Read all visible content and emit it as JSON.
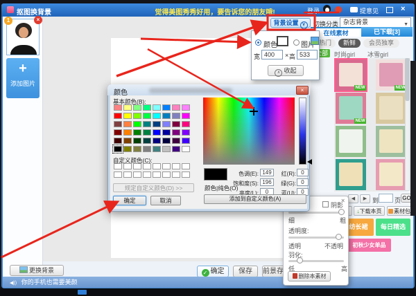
{
  "colors": {
    "annotation": "#e8251c",
    "titlebar_blue": "#2273cd",
    "accent_blue": "#2a8ad0",
    "tag_green": "#53b83a",
    "selected_pink": "#ff5d8f"
  },
  "icons": {
    "plus": "+",
    "speaker": "◀))",
    "dropdown": "▼",
    "collapse_caret": "∧",
    "settings_caret": "∨",
    "close": "×",
    "check": "✓",
    "prev": "◀",
    "next": "▶",
    "download_arrow": "↓"
  },
  "titlebar": {
    "title": "抠图换背景",
    "promo": "觉得美图秀秀好用，要告诉您的朋友哦!",
    "login": "登录",
    "feedback": "提意见"
  },
  "left_panel": {
    "photo_index": "1",
    "add_image": "添加图片",
    "change_background": "更换背景"
  },
  "bg_settings": {
    "button_label": "背景设置",
    "color_option": "颜色",
    "image_option": "图片",
    "width_label": "宽",
    "width_value": "400",
    "multiply": "×",
    "height_label": "高",
    "height_value": "533",
    "collapse_label": "收起"
  },
  "color_dialog": {
    "title": "颜色",
    "basic_colors_label": "基本颜色(B):",
    "custom_colors_label": "自定义颜色(C):",
    "define_custom_label": "规定自定义颜色(D) >>",
    "ok": "确定",
    "cancel": "取消",
    "solid_label": "颜色|纯色(O)",
    "add_custom": "添加到自定义颜色(A)",
    "preview_color": "#000000",
    "selected_index": 40,
    "fields": {
      "hue_label": "色调(E):",
      "hue": "149",
      "sat_label": "饱和度(S):",
      "sat": "196",
      "lum_label": "亮度(L):",
      "lum": "0",
      "red_label": "红(R):",
      "red": "0",
      "green_label": "绿(G):",
      "green": "0",
      "blue_label": "蓝(U):",
      "blue": "0"
    },
    "basic_colors": [
      "#FF8080",
      "#FFFF80",
      "#80FF80",
      "#00FF80",
      "#80FFFF",
      "#0080FF",
      "#FF80C0",
      "#FF80FF",
      "#FF0000",
      "#FFFF00",
      "#80FF00",
      "#00FF40",
      "#00FFFF",
      "#0080C0",
      "#8080C0",
      "#FF00FF",
      "#804040",
      "#FF8040",
      "#00FF00",
      "#008080",
      "#004080",
      "#8080FF",
      "#800040",
      "#FF0080",
      "#800000",
      "#FF8000",
      "#008000",
      "#008040",
      "#0000FF",
      "#0000A0",
      "#800080",
      "#8000FF",
      "#400000",
      "#804000",
      "#004000",
      "#004040",
      "#000080",
      "#000040",
      "#400040",
      "#4000FF",
      "#000000",
      "#808000",
      "#808040",
      "#808080",
      "#408080",
      "#C0C0C0",
      "#400080",
      "#FFFFFF"
    ],
    "custom_colors": [
      "#FFFFFF",
      "#FFFFFF",
      "#FFFFFF",
      "#FFFFFF",
      "#FFFFFF",
      "#FFFFFF",
      "#FFFFFF",
      "#FFFFFF",
      "#FFFFFF",
      "#FFFFFF",
      "#FFFFFF",
      "#FFFFFF",
      "#FFFFFF",
      "#FFFFFF",
      "#FFFFFF",
      "#FFFFFF"
    ]
  },
  "right_panel": {
    "category_label": "切换分类",
    "category_value": "杂志背景",
    "tabs": {
      "online": "在线素材",
      "downloaded": "已下载[3]"
    },
    "filters": {
      "hot": "热门",
      "fresh": "新鲜",
      "vip": "会员独享"
    },
    "tags": {
      "all": "全部",
      "fashion": "时尚girl",
      "ice": "冰雪girl"
    },
    "thumbnails": [
      {
        "bg": "#d96a8f",
        "inner": "#f3e0d6",
        "badge": "NEW",
        "selected": true
      },
      {
        "bg": "#f2dfdd",
        "inner": "#e09cb4",
        "badge": "NEW",
        "selected": false
      },
      {
        "bg": "#e07b97",
        "inner": "#9ed8c2",
        "badge": "NEW",
        "selected": false
      },
      {
        "bg": "#d8c8a0",
        "inner": "#eadfc0",
        "selected": false
      },
      {
        "bg": "#8fbe8a",
        "inner": "#f0f4ee",
        "selected": false
      },
      {
        "bg": "#9dbf9e",
        "inner": "#eee4c0",
        "selected": false
      },
      {
        "bg": "#2f9e8e",
        "inner": "#efe0b8",
        "selected": false
      },
      {
        "bg": "#e79cb1",
        "inner": "#f3e8c8",
        "selected": false
      }
    ],
    "pagination": {
      "to": "到",
      "page": "页",
      "go": "GO"
    },
    "prev_page_button": "上一页",
    "download_page": "下载本页",
    "material_pack": "素材包",
    "banners": [
      {
        "label": "雪纺长裙",
        "color": "#f7a83e"
      },
      {
        "label": "每日精选",
        "color": "#4ce08b"
      },
      {
        "label": "初秋少女单品",
        "color": "#f470a6"
      }
    ]
  },
  "material_panel": {
    "shadow": "阴影",
    "thin": "细",
    "thick": "粗",
    "opacity_label": "透明度:",
    "transparent": "透明",
    "opaque": "不透明",
    "feather_label": "羽化:",
    "low": "低",
    "high": "高",
    "delete_button": "删除本素材"
  },
  "action_bar": {
    "ok": "确定",
    "save": "保存",
    "save_foreground": "前景存为素材"
  },
  "status_bar": {
    "message": "你的手机也需要美颜"
  }
}
